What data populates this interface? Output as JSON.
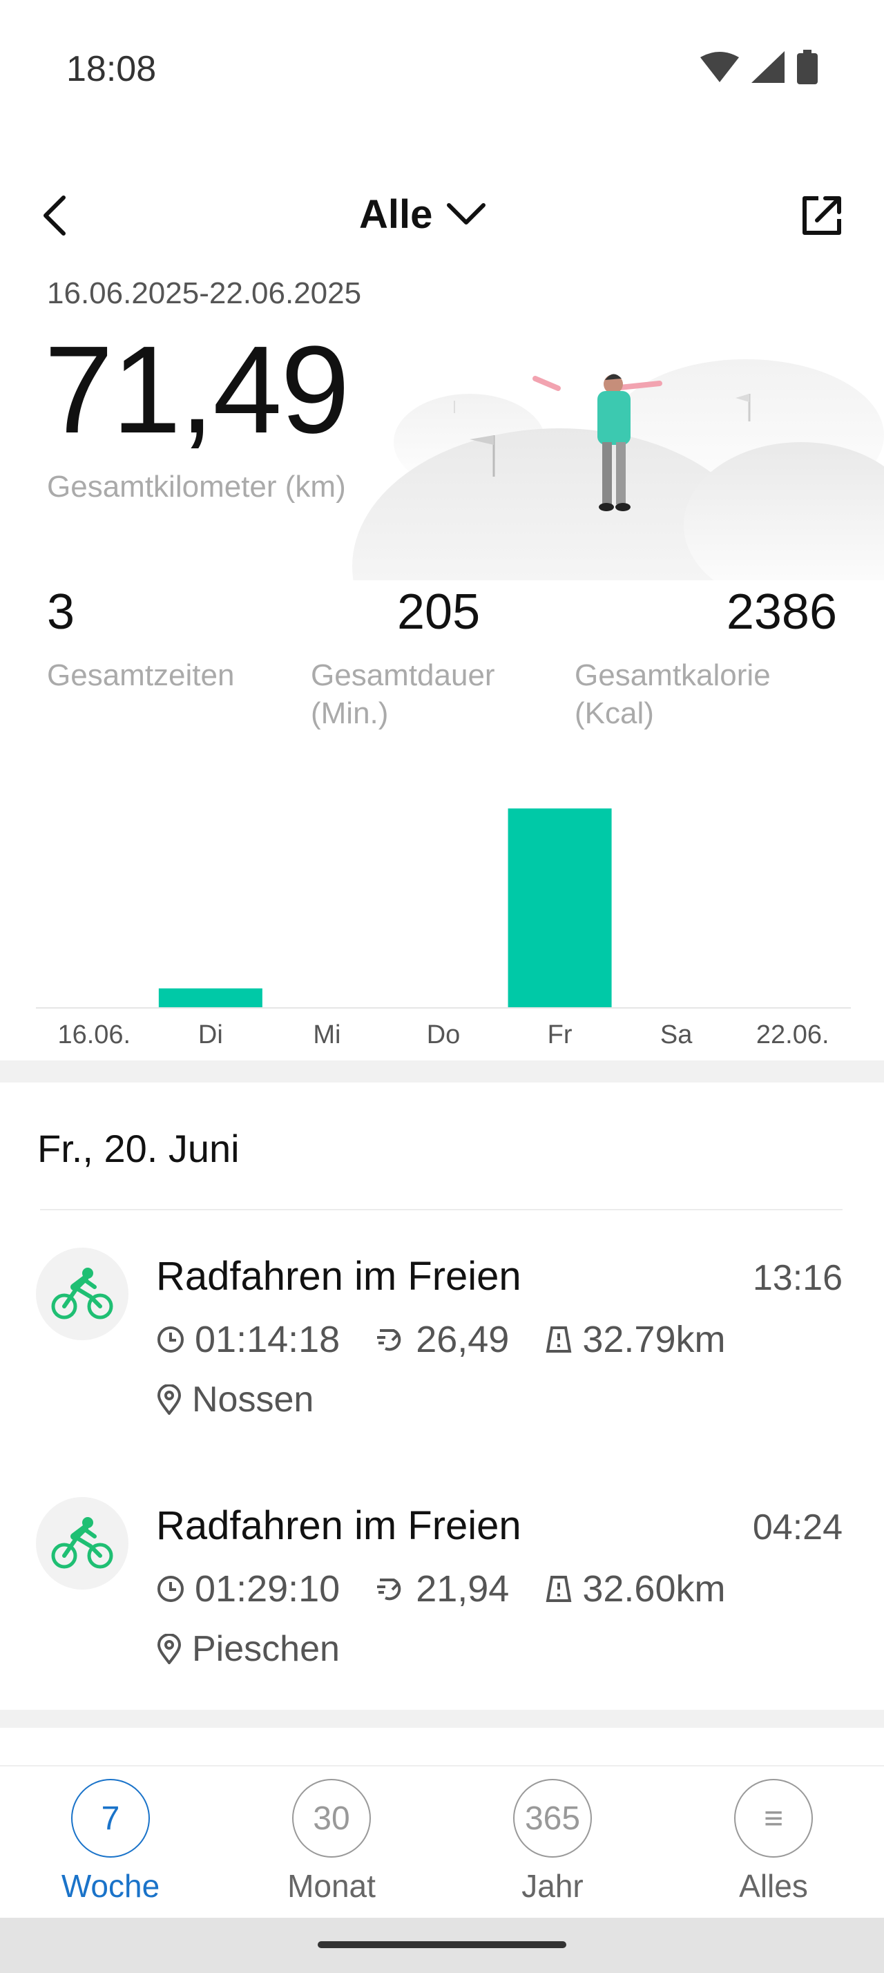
{
  "status_bar": {
    "time": "18:08"
  },
  "header": {
    "filter_label": "Alle"
  },
  "summary": {
    "date_range": "16.06.2025-22.06.2025",
    "total_km": "71,49",
    "total_km_label": "Gesamtkilometer (km)"
  },
  "stats": [
    {
      "value": "3",
      "label": "Gesamtzeiten"
    },
    {
      "value": "205",
      "label": "Gesamtdauer (Min.)"
    },
    {
      "value": "2386",
      "label": "Gesamtkalorie (Kcal)"
    }
  ],
  "chart_data": {
    "type": "bar",
    "categories": [
      "16.06.",
      "Di",
      "Mi",
      "Do",
      "Fr",
      "Sa",
      "22.06."
    ],
    "values": [
      0,
      6.2,
      0,
      0,
      65.39,
      0,
      0
    ],
    "ylim": [
      0,
      70
    ],
    "grid": false,
    "color": "#00c9a7"
  },
  "section": {
    "date_heading": "Fr., 20. Juni"
  },
  "activities": [
    {
      "icon": "bike-icon",
      "title": "Radfahren im Freien",
      "time": "13:16",
      "duration": "01:14:18",
      "speed": "26,49",
      "distance": "32.79km",
      "location": "Nossen"
    },
    {
      "icon": "bike-icon",
      "title": "Radfahren im Freien",
      "time": "04:24",
      "duration": "01:29:10",
      "speed": "21,94",
      "distance": "32.60km",
      "location": "Pieschen"
    }
  ],
  "bottom_nav": [
    {
      "number": "7",
      "label": "Woche",
      "active": true
    },
    {
      "number": "30",
      "label": "Monat",
      "active": false
    },
    {
      "number": "365",
      "label": "Jahr",
      "active": false
    },
    {
      "number": "≡",
      "label": "Alles",
      "active": false
    }
  ],
  "colors": {
    "accent": "#00c9a7",
    "nav_active": "#1a73c9",
    "activity_icon": "#1fbf73"
  }
}
